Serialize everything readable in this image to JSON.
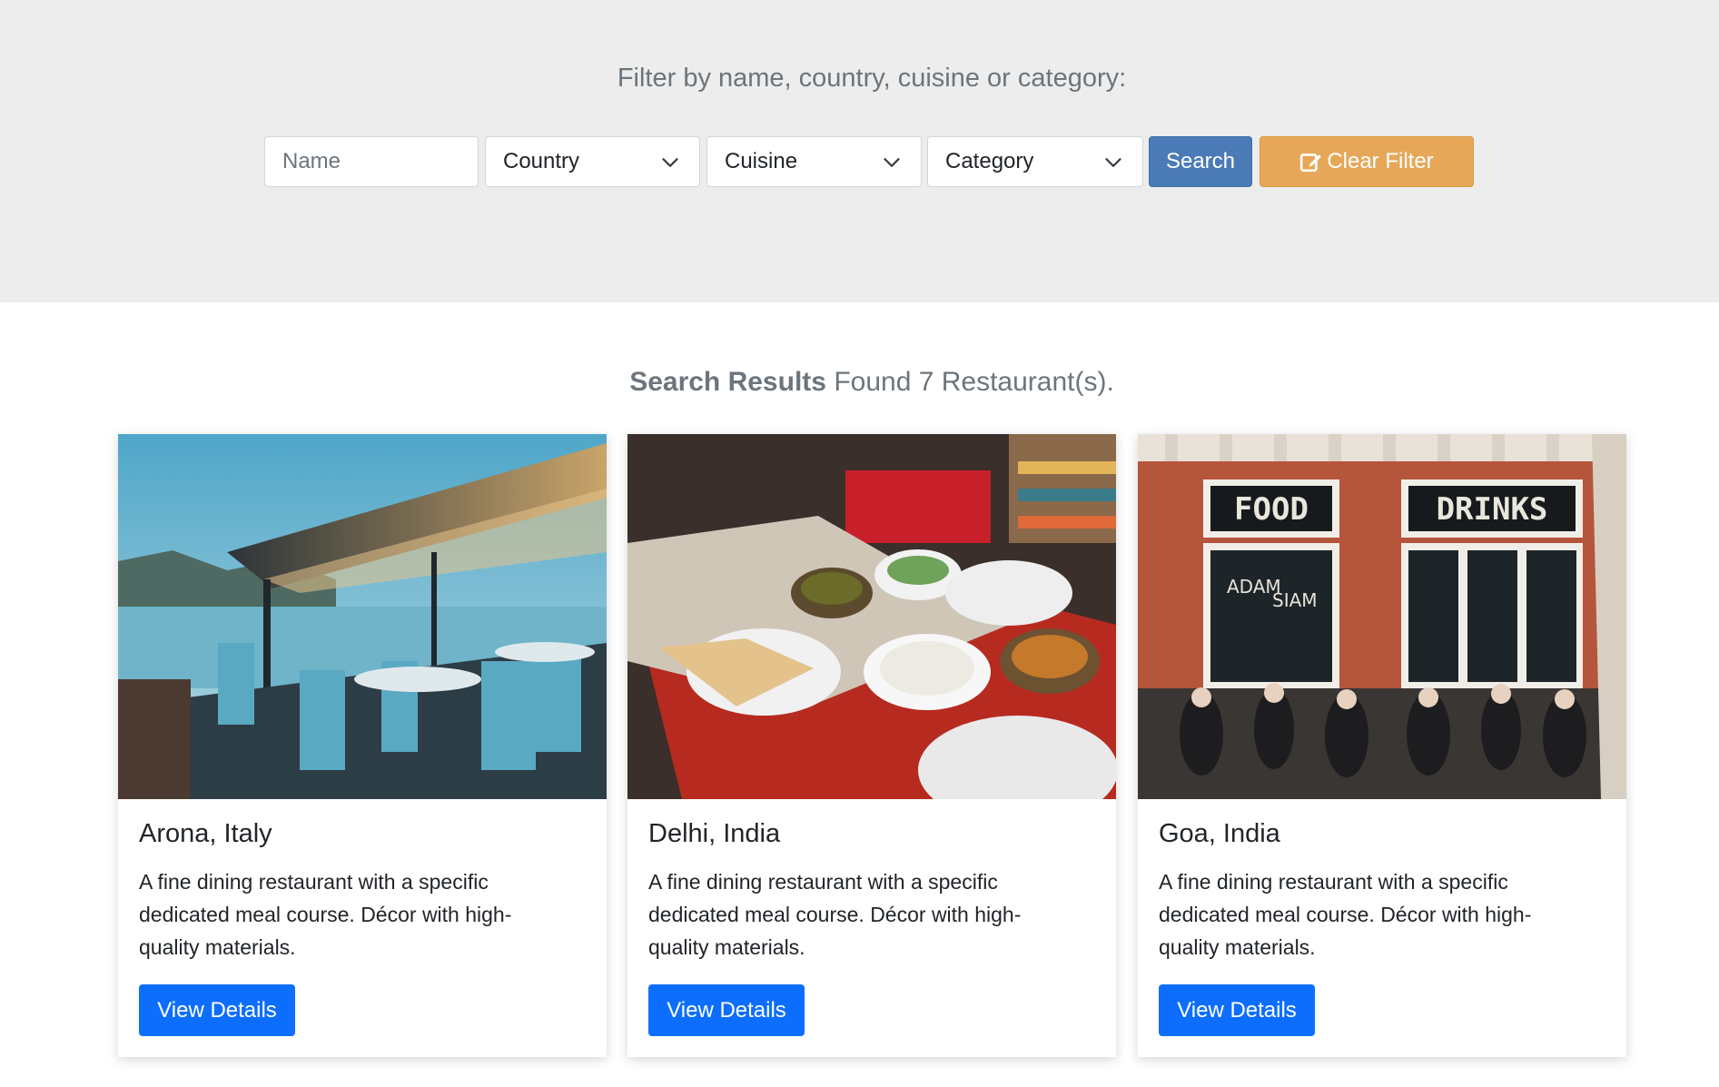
{
  "filter": {
    "title": "Filter by name, country, cuisine or category:",
    "name_placeholder": "Name",
    "country_selected": "Country",
    "cuisine_selected": "Cuisine",
    "category_selected": "Category",
    "search_label": "Search",
    "clear_label": "Clear Filter"
  },
  "results": {
    "heading_bold": "Search Results",
    "heading_count": "Found 7 Restaurant(s)."
  },
  "cards": [
    {
      "title": "Arona, Italy",
      "description": "A fine dining restaurant with a specific dedicated meal course. Décor with high-quality materials.",
      "button_label": "View Details",
      "image": "lakeside-terrace-dining-photo"
    },
    {
      "title": "Delhi, India",
      "description": "A fine dining restaurant with a specific dedicated meal course. Décor with high-quality materials.",
      "button_label": "View Details",
      "image": "indian-food-table-photo"
    },
    {
      "title": "Goa, India",
      "description": "A fine dining restaurant with a specific dedicated meal course. Décor with high-quality materials.",
      "button_label": "View Details",
      "image": "brick-restaurant-facade-photo",
      "photo_signs": [
        "FOOD",
        "DRINKS",
        "ADAM",
        "SIAM"
      ]
    }
  ],
  "colors": {
    "filter_band": "#ededed",
    "search_button": "#4a7bb7",
    "clear_button": "#e6a858",
    "primary_button": "#0d6efd"
  }
}
